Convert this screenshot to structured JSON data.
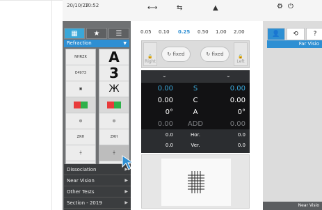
{
  "header": {
    "date": "20/10/27",
    "time": "10:52"
  },
  "left": {
    "menu_title": "Refraction",
    "charts": [
      {
        "big": "A",
        "small": "NHRZK\nZDRNV"
      },
      {
        "big": "3",
        "small": "E 4 9 7 3\n8 6 9 3 4"
      },
      {
        "big": "",
        "small": ""
      },
      {
        "big": "",
        "small": ""
      },
      {
        "big": "",
        "small": ""
      },
      {
        "big": "",
        "small": "Z R H\nZ R H"
      },
      {
        "big": "",
        "small": ""
      }
    ],
    "menu": [
      "Dissociation",
      "Near Vision",
      "Other Tests",
      "Section - 2019"
    ]
  },
  "lens_values": [
    "0.05",
    "0.10",
    "0.25",
    "0.50",
    "1.00",
    "2.00"
  ],
  "lens_selected": "0.25",
  "fixed": {
    "left_label": "Right",
    "right_label": "Left",
    "text": "fixed"
  },
  "data_rows": [
    {
      "left": "0.00",
      "mid": "S",
      "right": "0.00",
      "style": "blue"
    },
    {
      "left": "0.00",
      "mid": "C",
      "right": "0.00",
      "style": ""
    },
    {
      "left": "0°",
      "mid": "A",
      "right": "0°",
      "style": ""
    },
    {
      "left": "0.00",
      "mid": "ADD",
      "right": "0.00",
      "style": "dim"
    },
    {
      "left": "0.0",
      "mid": "Hor.",
      "right": "0.0",
      "style": ""
    },
    {
      "left": "0.0",
      "mid": "Ver.",
      "right": "0.0",
      "style": ""
    }
  ],
  "right": {
    "title": "Far Visio",
    "bottom": "Near Visio"
  },
  "colors": {
    "accent": "#3aa7d8",
    "panel_dark": "#121214"
  }
}
